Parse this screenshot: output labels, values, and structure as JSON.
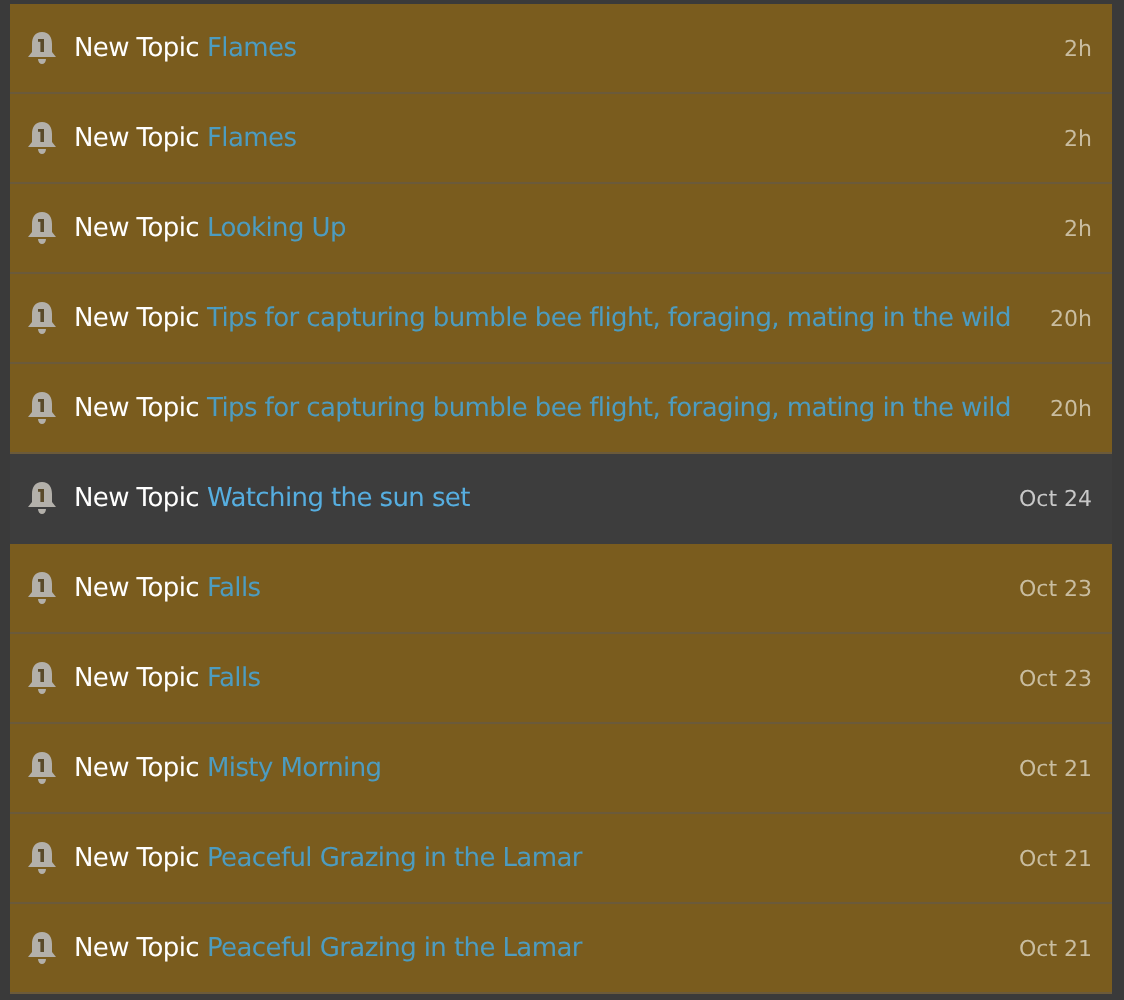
{
  "notifications": [
    {
      "label": "New Topic",
      "topic": "Flames",
      "time": "2h",
      "unread": true
    },
    {
      "label": "New Topic",
      "topic": "Flames",
      "time": "2h",
      "unread": true
    },
    {
      "label": "New Topic",
      "topic": "Looking Up",
      "time": "2h",
      "unread": true
    },
    {
      "label": "New Topic",
      "topic": "Tips for capturing bumble bee flight, foraging, mating in the wild",
      "time": "20h",
      "unread": true
    },
    {
      "label": "New Topic",
      "topic": "Tips for capturing bumble bee flight, foraging, mating in the wild",
      "time": "20h",
      "unread": true
    },
    {
      "label": "New Topic",
      "topic": "Watching the sun set",
      "time": "Oct 24",
      "unread": false
    },
    {
      "label": "New Topic",
      "topic": "Falls",
      "time": "Oct 23",
      "unread": true
    },
    {
      "label": "New Topic",
      "topic": "Falls",
      "time": "Oct 23",
      "unread": true
    },
    {
      "label": "New Topic",
      "topic": "Misty Morning",
      "time": "Oct 21",
      "unread": true
    },
    {
      "label": "New Topic",
      "topic": "Peaceful Grazing in the Lamar",
      "time": "Oct 21",
      "unread": true
    },
    {
      "label": "New Topic",
      "topic": "Peaceful Grazing in the Lamar",
      "time": "Oct 21",
      "unread": true
    }
  ]
}
